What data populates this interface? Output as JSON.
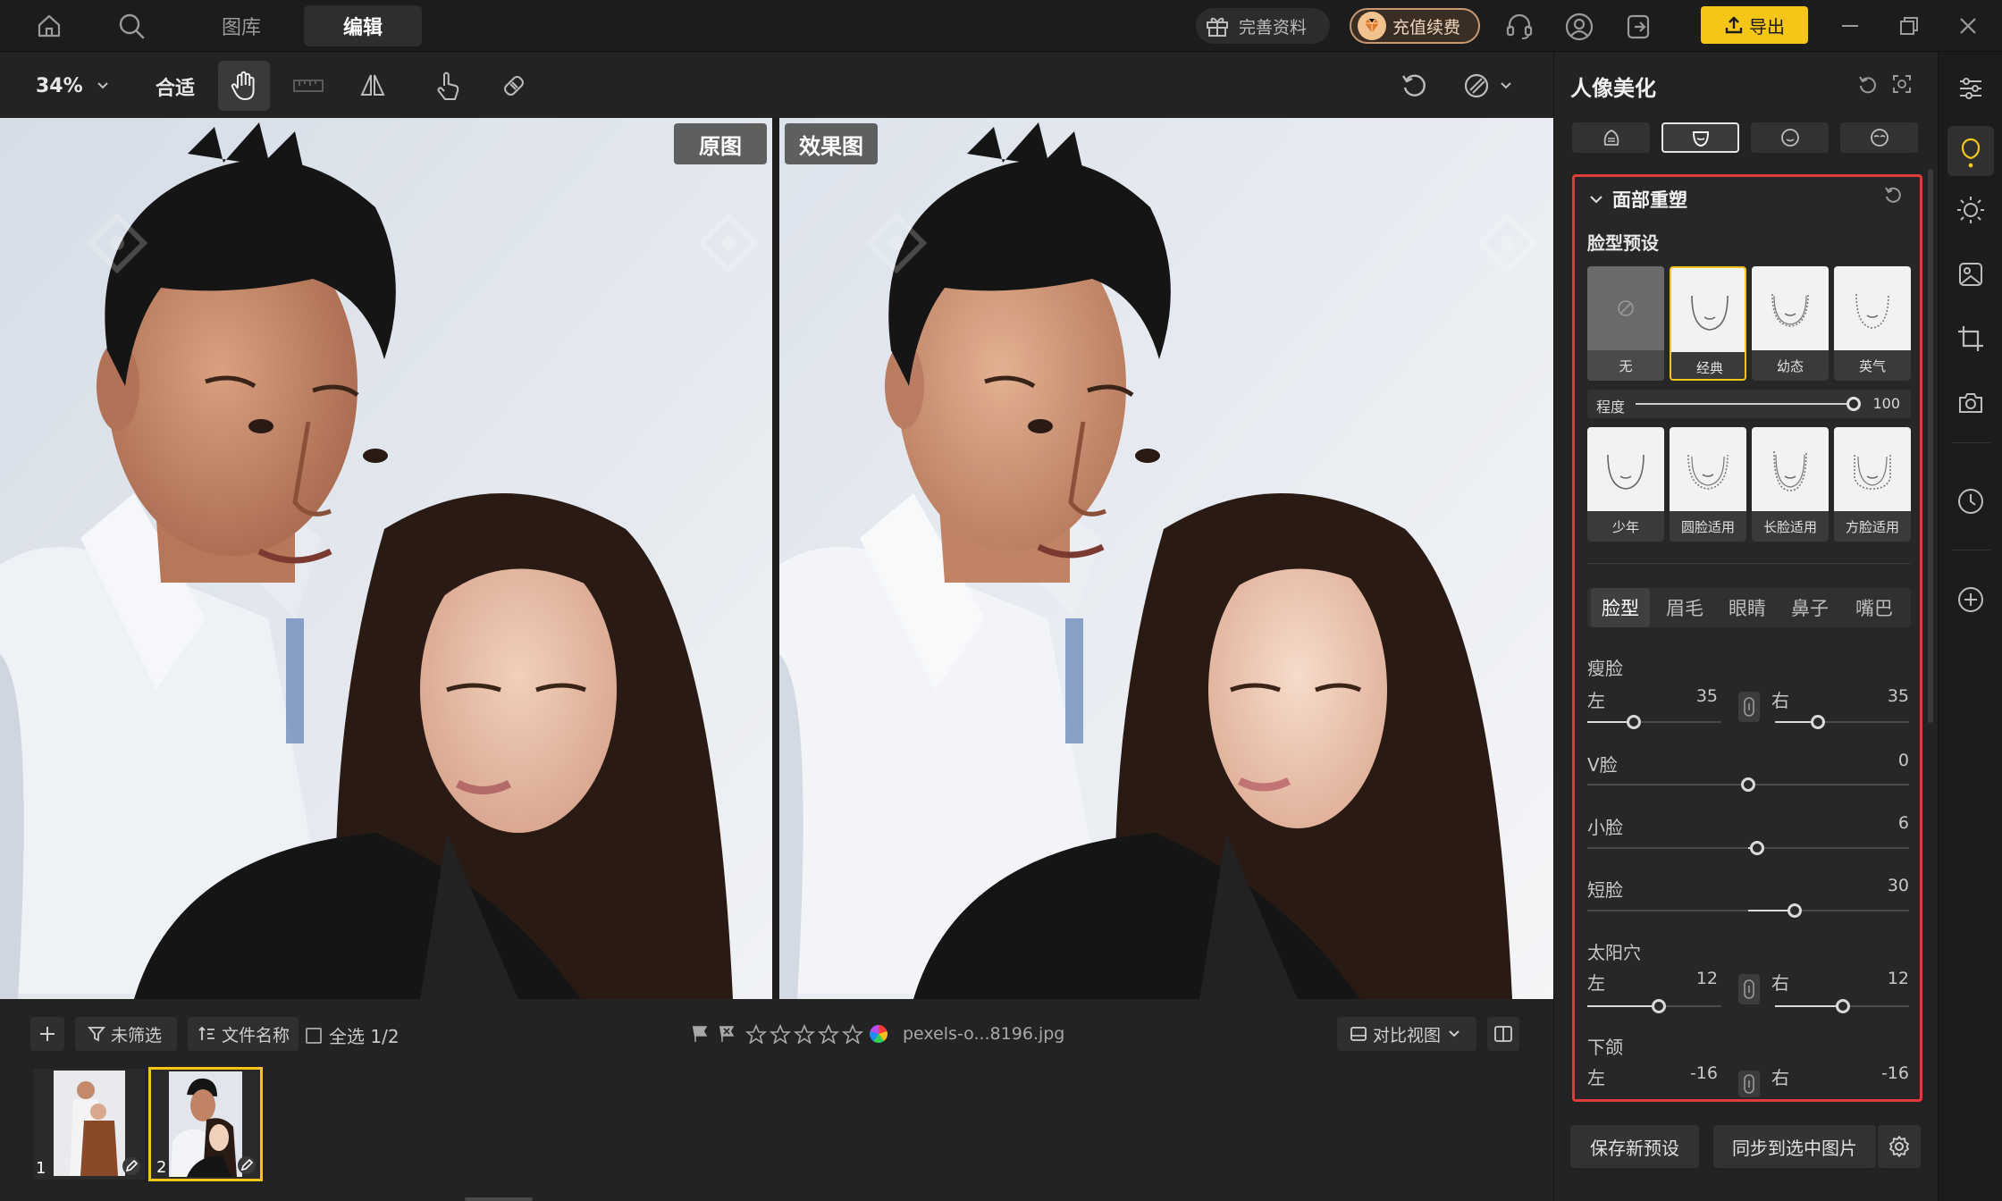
{
  "topbar": {
    "tabs": [
      {
        "label": "图库"
      },
      {
        "label": "编辑"
      }
    ],
    "complete_profile": "完善资料",
    "recharge": "充值续费",
    "export": "导出",
    "accent": "#f5c518"
  },
  "toolbar": {
    "zoom": "34%",
    "fit": "合适"
  },
  "viewer": {
    "original_label": "原图",
    "result_label": "效果图"
  },
  "bottombar": {
    "filter": "未筛选",
    "sort": "文件名称",
    "select_all": "全选 1/2",
    "filename": "pexels-o...8196.jpg",
    "compare_view": "对比视图",
    "thumbnails": [
      {
        "index": "1"
      },
      {
        "index": "2"
      }
    ]
  },
  "panel": {
    "title": "人像美化",
    "section": "面部重塑",
    "preset_heading": "脸型预设",
    "presets_row1": [
      {
        "label": "无"
      },
      {
        "label": "经典"
      },
      {
        "label": "幼态"
      },
      {
        "label": "英气"
      }
    ],
    "degree_label": "程度",
    "degree_value": "100",
    "presets_row2": [
      {
        "label": "少年"
      },
      {
        "label": "圆脸适用"
      },
      {
        "label": "长脸适用"
      },
      {
        "label": "方脸适用"
      }
    ],
    "subtabs": [
      {
        "label": "脸型"
      },
      {
        "label": "眉毛"
      },
      {
        "label": "眼睛"
      },
      {
        "label": "鼻子"
      },
      {
        "label": "嘴巴"
      }
    ],
    "sliders": {
      "thin_face": {
        "label": "瘦脸",
        "left_label": "左",
        "left_value": "35",
        "right_label": "右",
        "right_value": "35"
      },
      "v_face": {
        "label": "V脸",
        "value": "0"
      },
      "small_face": {
        "label": "小脸",
        "value": "6"
      },
      "short_face": {
        "label": "短脸",
        "value": "30"
      },
      "temple": {
        "label": "太阳穴",
        "left_label": "左",
        "left_value": "12",
        "right_label": "右",
        "right_value": "12"
      },
      "jaw": {
        "label": "下颌",
        "left_label": "左",
        "left_value": "-16",
        "right_label": "右",
        "right_value": "-16"
      }
    },
    "save_preset": "保存新预设",
    "sync": "同步到选中图片",
    "highlight_color": "#e03c3c"
  }
}
